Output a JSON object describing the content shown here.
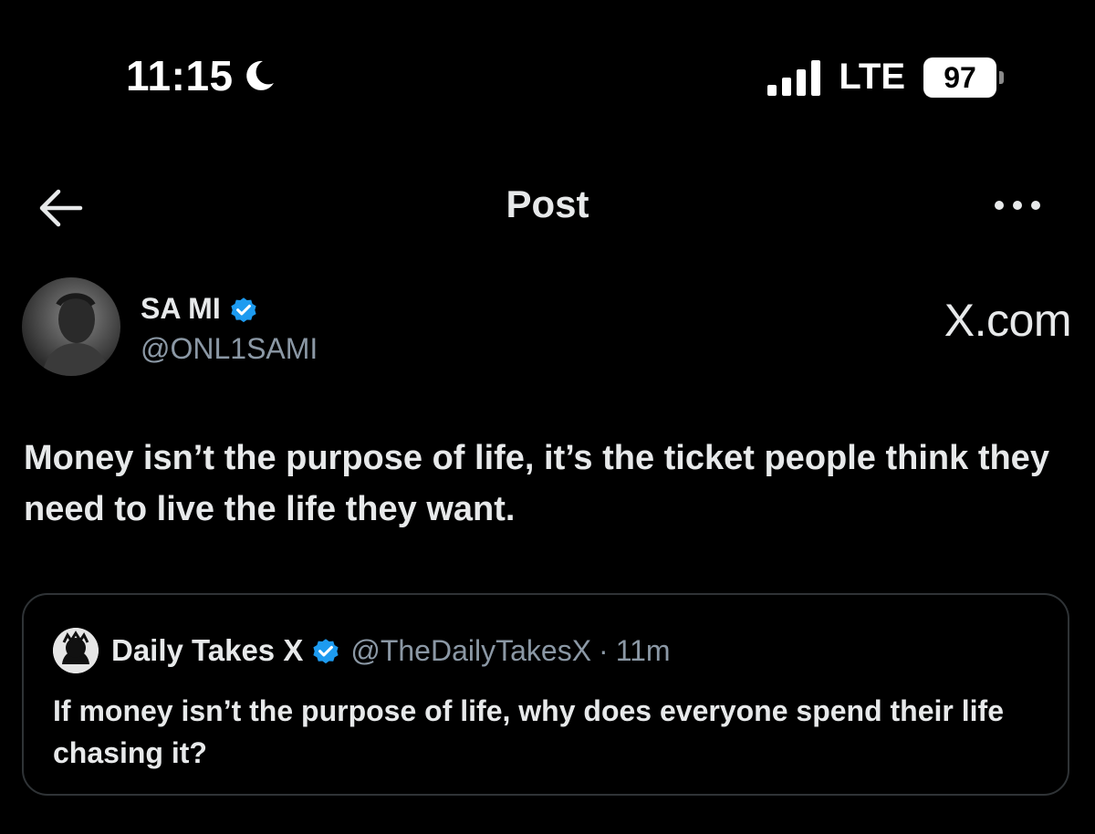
{
  "status_bar": {
    "time": "11:15",
    "network": "LTE",
    "battery": "97"
  },
  "header": {
    "title": "Post"
  },
  "post": {
    "author_name": "SA MI",
    "author_handle": "@ONL1SAMI",
    "source_label": "X.com",
    "text": "Money isn’t the purpose of life, it’s the ticket people think they need to live the life they want."
  },
  "quoted_post": {
    "author_name": "Daily Takes X",
    "author_handle": "@TheDailyTakesX",
    "separator": "·",
    "time": "11m",
    "text": "If money isn’t the purpose of life, why does everyone spend their life chasing it?"
  },
  "colors": {
    "background": "#000000",
    "text_primary": "#e7e9ea",
    "text_secondary": "#8b98a5",
    "verified_blue": "#1d9bf0",
    "border": "#2f3336"
  },
  "icons": {
    "status_moon": "moon-icon",
    "status_signal": "signal-icon",
    "back": "arrow-left-icon",
    "more": "more-horizontal-icon",
    "verified": "verified-badge-icon"
  }
}
